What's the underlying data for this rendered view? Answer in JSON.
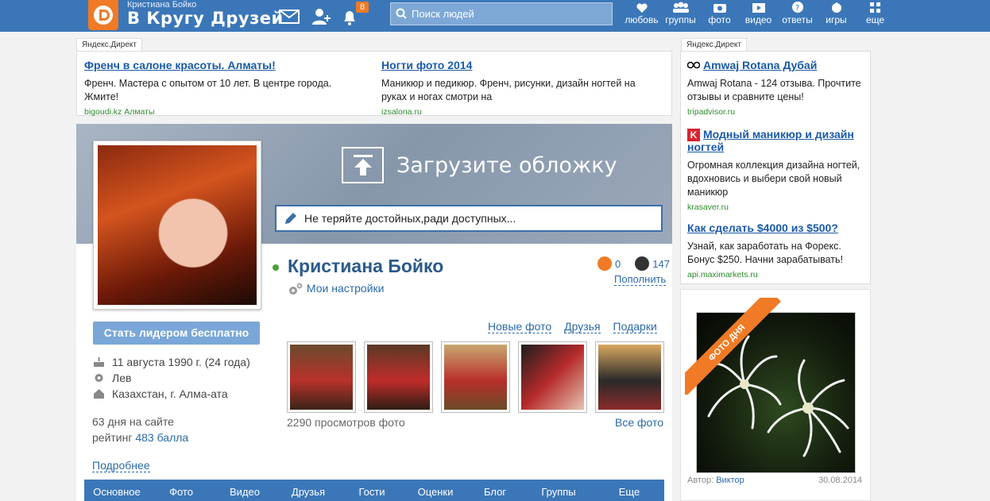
{
  "header": {
    "user_small": "Кристиана Бойко",
    "logo_text": "В Кругу Друзей",
    "notifications_count": "8",
    "search_placeholder": "Поиск людей",
    "nav": [
      "любовь",
      "группы",
      "фото",
      "видео",
      "ответы",
      "игры",
      "еще"
    ]
  },
  "ads_left": {
    "tag": "Яндекс.Директ",
    "items": [
      {
        "title": "Френч в салоне красоты. Алматы!",
        "text": "Френч. Мастера с опытом от 10 лет. В центре города. Жмите!",
        "url": "bigoudi.kz  Алматы"
      },
      {
        "title": "Ногти фото 2014",
        "text": "Маникюр и педикюр. Френч, рисунки, дизайн ногтей на руках и ногах смотри на",
        "url": "izsalona.ru"
      }
    ]
  },
  "ads_right": {
    "tag": "Яндекс.Директ",
    "items": [
      {
        "title": "Amwaj Rotana Дубай",
        "text": "Amwaj Rotana - 124 отзыва. Прочтите отзывы и сравните цены!",
        "url": "tripadvisor.ru"
      },
      {
        "title": "Модный маникюр и дизайн ногтей",
        "text": "Огромная коллекция дизайна ногтей, вдохновись и выбери свой новый маникюр",
        "url": "krasaver.ru"
      },
      {
        "title": "Как сделать $4000 из $500?",
        "text": "Узнай, как заработать на Форекс. Бонус $250. Начни зарабатывать!",
        "url": "api.maximarkets.ru"
      }
    ]
  },
  "profile": {
    "upload_cover": "Загрузите обложку",
    "status": "Не теряйте достойных,ради доступных...",
    "name": "Кристиана Бойко",
    "settings": "Мои настройки",
    "coins_orange": "0",
    "coins_dark": "147",
    "topup": "Пополнить",
    "leader_button": "Стать лидером бесплатно",
    "birthday": "11 августа 1990 г. (24 года)",
    "zodiac": "Лев",
    "location": "Казахстан, г. Алма-ата",
    "days_on_site": "63 дня на сайте",
    "rating_label": "рейтинг",
    "rating_value": "483 балла",
    "more": "Подробнее",
    "photo_links": [
      "Новые фото",
      "Друзья",
      "Подарки"
    ],
    "views": "2290 просмотров фото",
    "all_photos": "Все фото",
    "tabs": [
      "Основное",
      "Фото",
      "Видео",
      "Друзья",
      "Гости",
      "Оценки",
      "Блог",
      "Группы",
      "Еще"
    ]
  },
  "photo_of_day": {
    "ribbon": "ФОТО ДНЯ",
    "author_label": "Автор:",
    "author": "Виктор",
    "date": "30.08.2014"
  }
}
